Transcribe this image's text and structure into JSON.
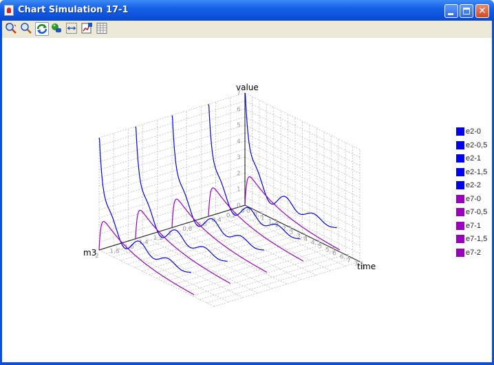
{
  "window": {
    "title": "Chart Simulation 17-1",
    "controls": {
      "minimize": "minimize",
      "maximize": "maximize",
      "close": "close"
    },
    "colors": {
      "titlebar": "#0b4fd8",
      "toolbar": "#ece9d8",
      "close": "#d24a22"
    }
  },
  "toolbar": {
    "buttons": [
      {
        "name": "zoom-area-button",
        "icon": "zoom-area-icon",
        "pressed": false
      },
      {
        "name": "zoom-button",
        "icon": "magnifier-icon",
        "pressed": false
      },
      {
        "name": "rotate-button",
        "icon": "rotate-arrows-icon",
        "pressed": true
      },
      {
        "name": "move-button",
        "icon": "move-hand-icon",
        "pressed": false
      },
      {
        "name": "fit-button",
        "icon": "fit-grid-icon",
        "pressed": false
      },
      {
        "name": "export-button",
        "icon": "export-chart-icon",
        "pressed": false
      },
      {
        "name": "table-view-button",
        "icon": "table-icon",
        "pressed": false
      }
    ]
  },
  "chart_data": {
    "type": "line",
    "dimensions": "3d",
    "axis_labels": {
      "x": "time",
      "y": "m3",
      "z": "value"
    },
    "time_ticks": [
      "0",
      "0,5",
      "1",
      "1,5",
      "2",
      "2,5",
      "3",
      "3,5",
      "4",
      "4,5",
      "5",
      "5,5",
      "6",
      "6,5",
      "7",
      "7,5",
      "8"
    ],
    "m3_ticks": [
      "0",
      "0,2",
      "0,4",
      "0,6",
      "0,8",
      "1",
      "1,2",
      "1,4",
      "1,6",
      "1,8",
      "2"
    ],
    "value_ticks": [
      "0",
      "1",
      "2",
      "3",
      "4",
      "5",
      "6",
      "7"
    ],
    "grid": true,
    "legend_position": "right",
    "colors": {
      "e2": "#0000ee",
      "e7": "#9900bb"
    },
    "series": [
      {
        "name": "e2-0",
        "group": "e2",
        "m3": 0,
        "peak": 7.0
      },
      {
        "name": "e2-0,5",
        "group": "e2",
        "m3": 0.5,
        "peak": 7.0
      },
      {
        "name": "e2-1",
        "group": "e2",
        "m3": 1,
        "peak": 7.0
      },
      {
        "name": "e2-1,5",
        "group": "e2",
        "m3": 1.5,
        "peak": 7.0
      },
      {
        "name": "e2-2",
        "group": "e2",
        "m3": 2,
        "peak": 7.0
      },
      {
        "name": "e7-0",
        "group": "e7",
        "m3": 0,
        "peak": 2.4
      },
      {
        "name": "e7-0,5",
        "group": "e7",
        "m3": 0.5,
        "peak": 2.4
      },
      {
        "name": "e7-1",
        "group": "e7",
        "m3": 1,
        "peak": 2.4
      },
      {
        "name": "e7-1,5",
        "group": "e7",
        "m3": 1.5,
        "peak": 2.4
      },
      {
        "name": "e7-2",
        "group": "e7",
        "m3": 2,
        "peak": 2.4
      }
    ]
  }
}
